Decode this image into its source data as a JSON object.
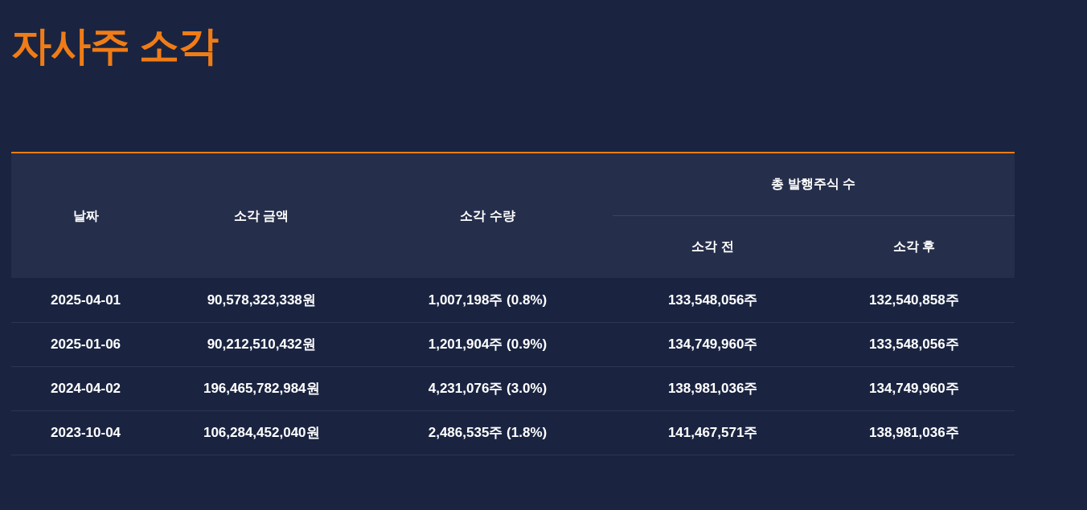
{
  "title": "자사주 소각",
  "table": {
    "columns": [
      {
        "label": "날짜"
      },
      {
        "label": "소각 금액"
      },
      {
        "label": "소각 수량"
      }
    ],
    "group": {
      "label": "총 발행주식 수",
      "columns": [
        {
          "label": "소각 전"
        },
        {
          "label": "소각 후"
        }
      ]
    },
    "rows": [
      {
        "cells": [
          "2025-04-01",
          "90,578,323,338원",
          "1,007,198주 (0.8%)",
          "133,548,056주",
          "132,540,858주"
        ]
      },
      {
        "cells": [
          "2025-01-06",
          "90,212,510,432원",
          "1,201,904주 (0.9%)",
          "134,749,960주",
          "133,548,056주"
        ]
      },
      {
        "cells": [
          "2024-04-02",
          "196,465,782,984원",
          "4,231,076주 (3.0%)",
          "138,981,036주",
          "134,749,960주"
        ]
      },
      {
        "cells": [
          "2023-10-04",
          "106,284,452,040원",
          "2,486,535주 (1.8%)",
          "141,467,571주",
          "138,981,036주"
        ]
      }
    ]
  }
}
